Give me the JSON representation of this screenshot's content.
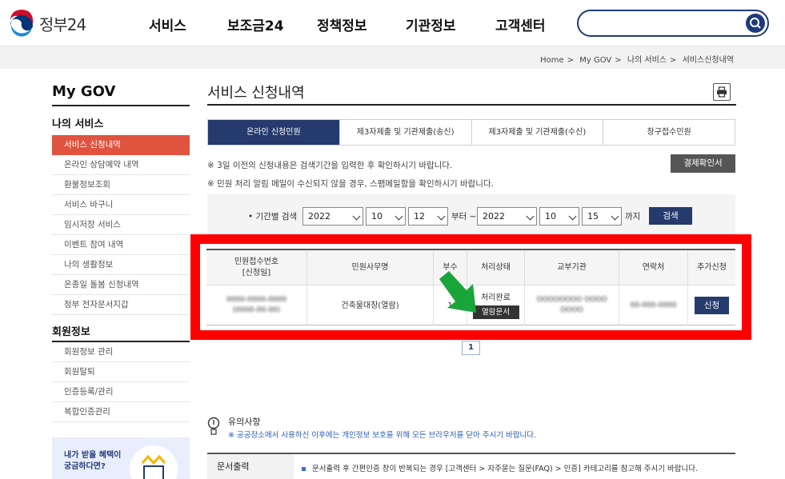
{
  "header": {
    "logo_text": "정부24",
    "nav": [
      "서비스",
      "보조금24",
      "정책정보",
      "기관정보",
      "고객센터"
    ],
    "search_placeholder": "",
    "brand_color": "#1f3a7a"
  },
  "breadcrumb": [
    "Home",
    "My GOV",
    "나의 서비스",
    "서비스신청내역"
  ],
  "sidebar": {
    "title": "My GOV",
    "section1": "나의 서비스",
    "items1": [
      "서비스 신청내역",
      "온라인 상담예약 내역",
      "환불정보조회",
      "서비스 바구니",
      "임시저장 서비스",
      "이벤트 참여 내역",
      "나의 생활정보",
      "온종일 돌봄 신청내역",
      "정부 전자문서지갑"
    ],
    "active_index": 0,
    "section2": "회원정보",
    "items2": [
      "회원정보 관리",
      "회원탈퇴",
      "인증등록/관리",
      "복합인증관리"
    ],
    "banner_line1": "내가 받을 혜택이",
    "banner_line2": "궁금하다면?"
  },
  "main": {
    "title": "서비스 신청내역",
    "tabs": [
      "온라인 신청민원",
      "제3자제출 및 기관제출(송신)",
      "제3자제출 및 기관제출(수신)",
      "창구접수민원"
    ],
    "active_tab": 0,
    "notice1": "※ 3일 이전의 신청내용은 검색기간을 입력한 후 확인하시기 바랍니다.",
    "notice2": "※ 민원 처리 알림 메일이 수신되지 않을 경우, 스팸메일함을 확인하시기 바랍니다.",
    "receipt_button": "결제확인서",
    "period": {
      "label": "• 기간별 검색",
      "from_year": "2022",
      "from_month": "10",
      "from_day": "12",
      "sep": "부터 ~",
      "to_year": "2022",
      "to_month": "10",
      "to_day": "15",
      "until": "까지",
      "search_button": "검색"
    },
    "table": {
      "headers": [
        "민원접수번호\n[신청일]",
        "민원사무명",
        "부수",
        "처리상태",
        "교부기관",
        "연락처",
        "추가신청"
      ],
      "row": {
        "receipt_no": "0000-0000-0000",
        "receipt_date": "(0000-00-00)",
        "service": "건축물대장(열람)",
        "copies": "1",
        "status": "처리완료",
        "open_doc": "열람문서",
        "agency": "OOOOOOOO OOOO OOOO",
        "contact": "00-000-0000",
        "apply_button": "신청"
      }
    },
    "page": "1",
    "caution_title": "유의사항",
    "caution_text": "※ 공공장소에서 사용하신 이후에는 개인정보 보호를 위해 모든 브라우저를 닫아 주시기 바랍니다.",
    "doc_head": "문서출력",
    "doc_text": "문서출력 후 간편인증 창이 반복되는 경우 [고객센터 > 자주묻는 질문(FAQ) > 인증] 카테고리를 참고해 주시기 바랍니다."
  },
  "colors": {
    "active_menu": "#e0533f",
    "navy": "#253b6e",
    "highlight": "#ff0000",
    "arrow": "#19a53a"
  }
}
